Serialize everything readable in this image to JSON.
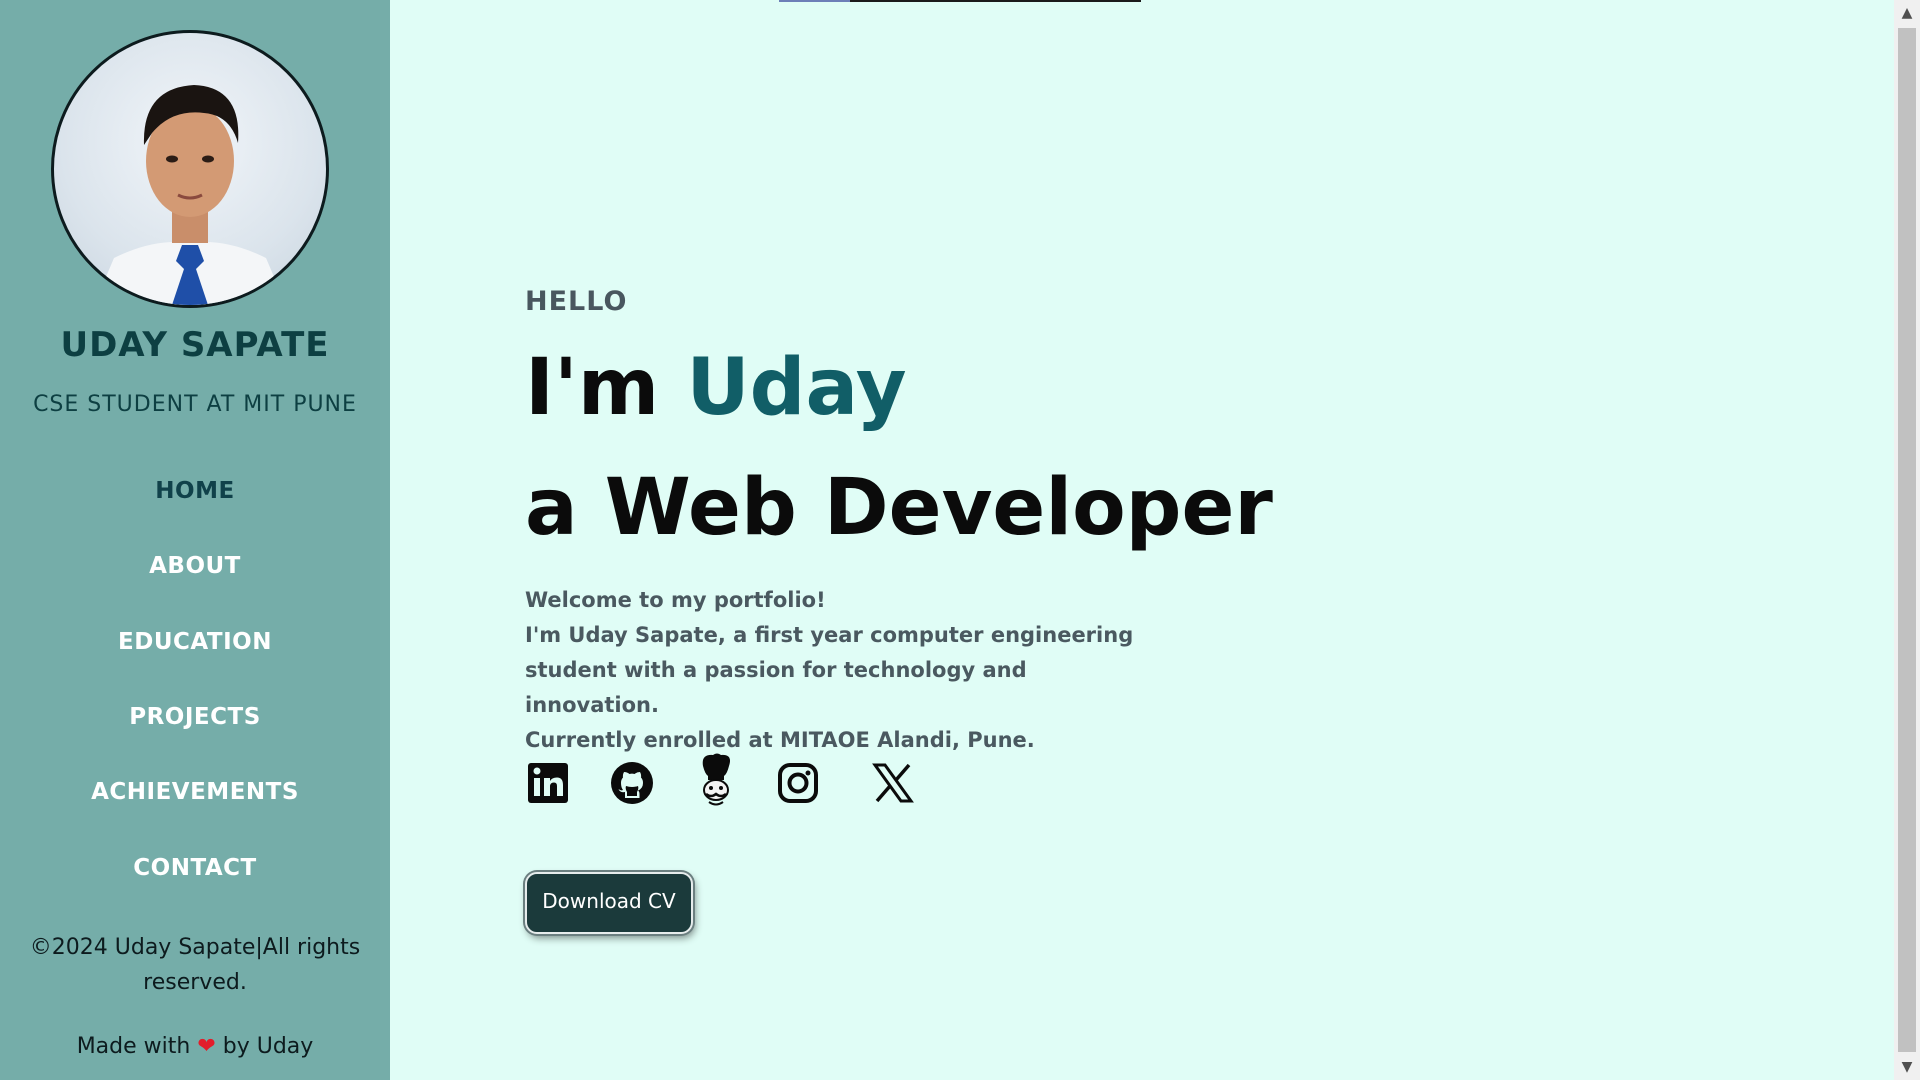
{
  "sidebar": {
    "name": "UDAY SAPATE",
    "role": "CSE STUDENT AT MIT PUNE",
    "nav": [
      "HOME",
      "ABOUT",
      "EDUCATION",
      "PROJECTS",
      "ACHIEVEMENTS",
      "CONTACT"
    ],
    "active_nav": "HOME",
    "copyright": "©2024 Uday Sapate|All rights reserved.",
    "made_with_prefix": "Made with",
    "heart": "❤",
    "made_with_suffix": "by Uday"
  },
  "hero": {
    "hello": "HELLO",
    "line1_prefix": "I'm",
    "line1_name": "Uday",
    "line2": "a Web Developer",
    "intro_line1": "Welcome to my portfolio!",
    "intro_line2": "I'm Uday Sapate, a first year computer engineering student with a passion for technology and innovation.",
    "intro_line3": "Currently enrolled at MITAOE Alandi, Pune.",
    "cv_button": "Download CV"
  },
  "socials": [
    {
      "name": "linkedin-icon"
    },
    {
      "name": "github-icon"
    },
    {
      "name": "codechef-icon"
    },
    {
      "name": "instagram-icon"
    },
    {
      "name": "x-icon"
    }
  ],
  "scrollbar": {
    "up": "▲",
    "down": "▼"
  },
  "colors": {
    "sidebar_bg": "#75ada9",
    "page_bg": "#e0fdf6",
    "accent": "#115e67",
    "button_bg": "#1b3a3b"
  }
}
